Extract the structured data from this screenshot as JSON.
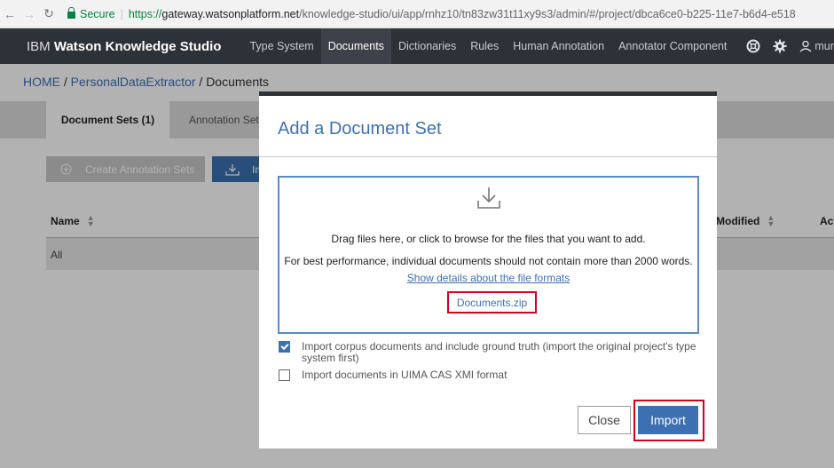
{
  "browser": {
    "secure_label": "Secure",
    "url_scheme": "https://",
    "url_host": "gateway.watsonplatform.net",
    "url_path": "/knowledge-studio/ui/app/rnhz10/tn83zw31t11xy9s3/admin/#/project/dbca6ce0-b225-11e7-b6d4-e518"
  },
  "app": {
    "brand_prefix": "IBM",
    "brand_name": "Watson Knowledge Studio",
    "nav": [
      "Type System",
      "Documents",
      "Dictionaries",
      "Rules",
      "Human Annotation",
      "Annotator Component"
    ],
    "active_nav": "Documents",
    "user_label": "mura"
  },
  "breadcrumb": {
    "home": "HOME",
    "sep1": " / ",
    "project": "PersonalDataExtractor",
    "sep2": " / ",
    "current": "Documents"
  },
  "tabs": {
    "document_sets": "Document Sets (1)",
    "annotation_sets": "Annotation Set"
  },
  "toolbar": {
    "create_annotation_sets": "Create Annotation Sets",
    "import_partial": "Im"
  },
  "table": {
    "col_name": "Name",
    "col_modified": "Modified",
    "col_actions": "Act",
    "rows": [
      "All"
    ]
  },
  "modal": {
    "title": "Add a Document Set",
    "drop_text": "Drag files here, or click to browse for the files that you want to add.",
    "perf_text": "For best performance, individual documents should not contain more than 2000 words.",
    "details_link": "Show details about the file formats",
    "selected_file": "Documents.zip",
    "option1_label": "Import corpus documents and include ground truth (import the original project's type system first)",
    "option1_checked": true,
    "option2_label": "Import documents in UIMA CAS XMI format",
    "option2_checked": false,
    "close_label": "Close",
    "import_label": "Import"
  },
  "colors": {
    "accent": "#3d70b2",
    "header_bg": "#2d3138",
    "highlight": "#d0021b",
    "secure": "#0b8043"
  }
}
